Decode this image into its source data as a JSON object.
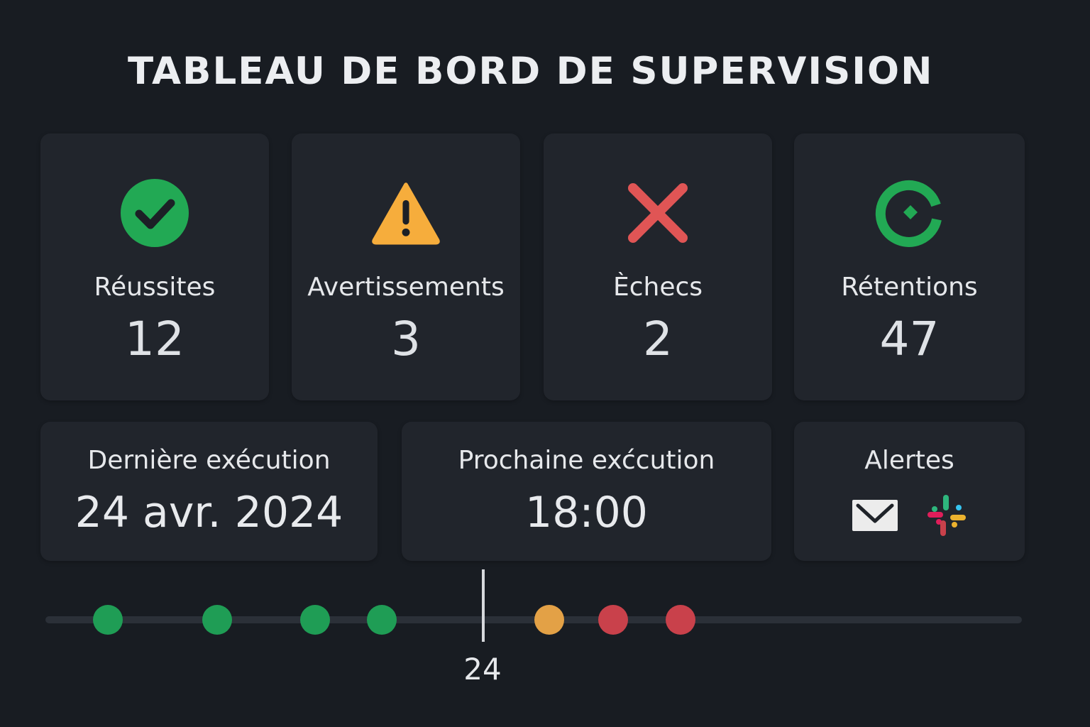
{
  "title": "TABLEAU DE BORD DE SUPERVISION",
  "stats": [
    {
      "label": "Réussites",
      "value": "12",
      "icon": "check-circle-icon",
      "color": "#22a954"
    },
    {
      "label": "Avertissements",
      "value": "3",
      "icon": "warning-triangle-icon",
      "color": "#f6ad3c"
    },
    {
      "label": "Èchecs",
      "value": "2",
      "icon": "close-x-icon",
      "color": "#e05555"
    },
    {
      "label": "Rétentions",
      "value": "47",
      "icon": "retention-ring-icon",
      "color": "#22a954"
    }
  ],
  "last_run": {
    "label": "Dernière exécution",
    "value": "24 avr. 2024"
  },
  "next_run": {
    "label": "Prochaine exćcution",
    "value": "18:00"
  },
  "alerts": {
    "label": "Alertes",
    "channels": [
      "email-icon",
      "slack-icon"
    ]
  },
  "timeline": {
    "marker_label": "24",
    "events": [
      {
        "status": "success",
        "color": "#1f9d55"
      },
      {
        "status": "success",
        "color": "#1f9d55"
      },
      {
        "status": "success",
        "color": "#1f9d55"
      },
      {
        "status": "success",
        "color": "#1f9d55"
      },
      {
        "status": "warning",
        "color": "#e3a146"
      },
      {
        "status": "failure",
        "color": "#c9414b"
      },
      {
        "status": "failure",
        "color": "#c9414b"
      }
    ]
  }
}
